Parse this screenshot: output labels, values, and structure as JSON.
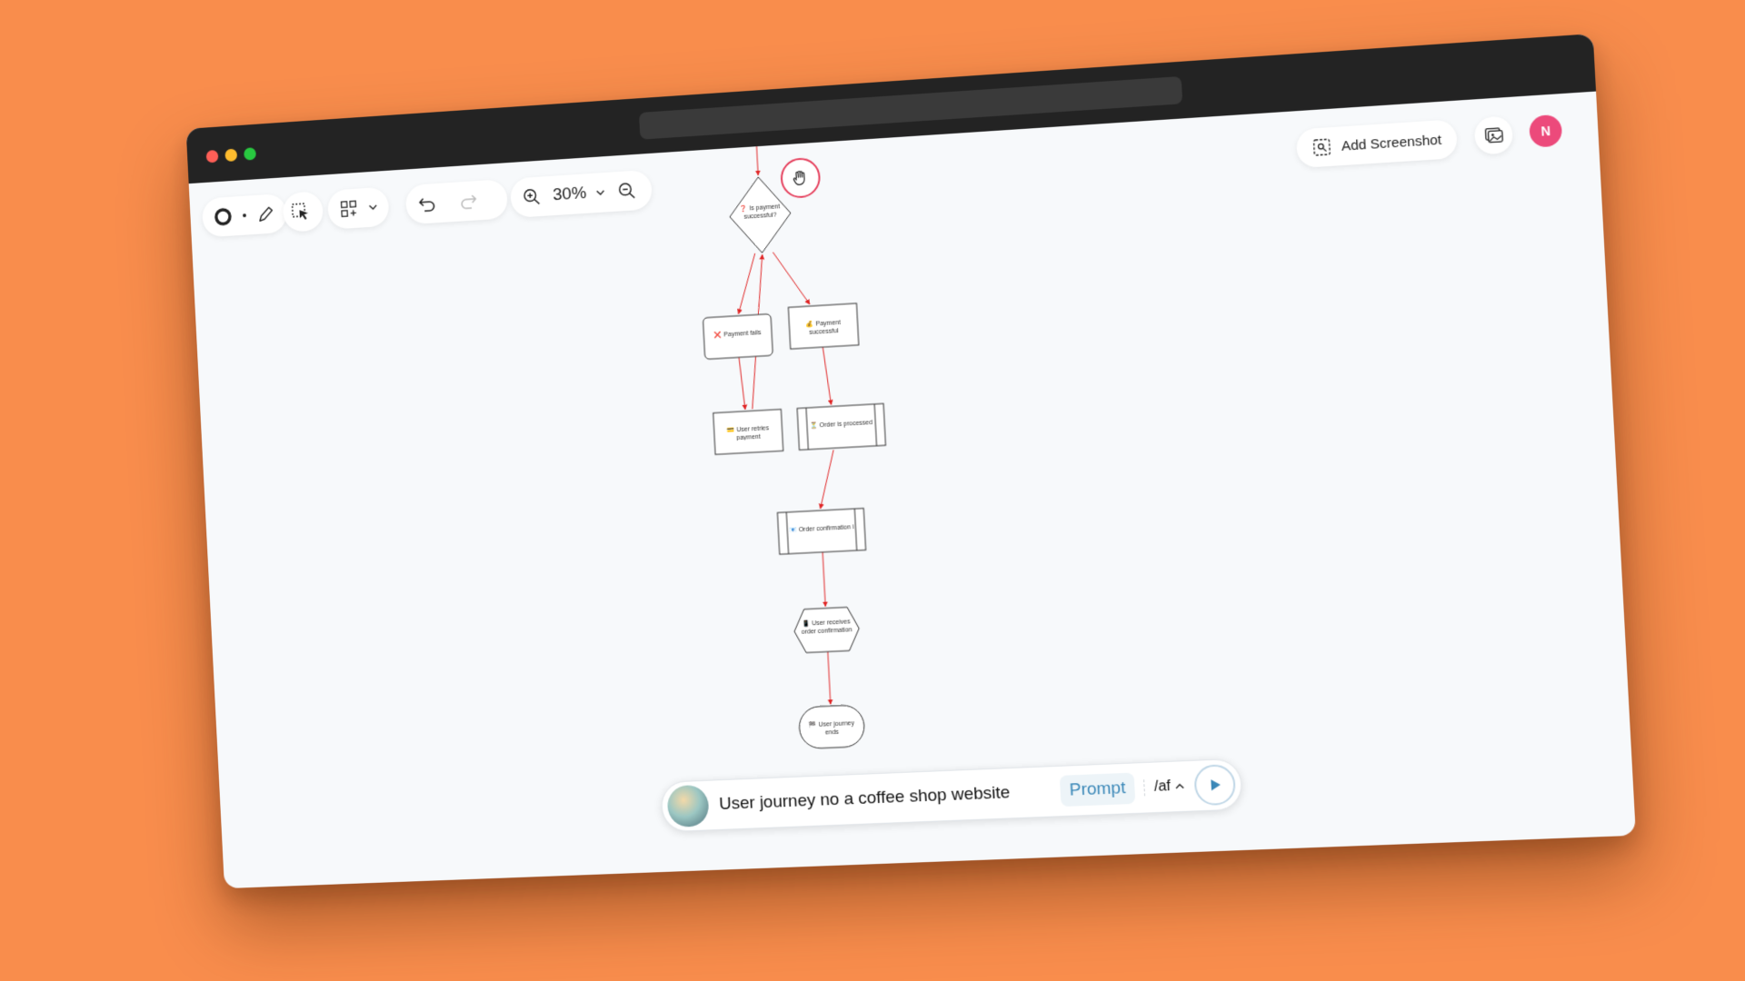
{
  "toolbar": {
    "zoom_level": "30%",
    "screenshot_label": "Add Screenshot"
  },
  "user": {
    "avatar_initial": "N"
  },
  "flowchart": {
    "nodes": {
      "decision": "❓ Is payment successful?",
      "payment_fails": "❌ Payment fails",
      "payment_success": "💰 Payment successful",
      "retry_payment": "💳 User retries payment",
      "order_processed": "⏳ Order is processed",
      "confirmation_sent": "📧 Order confirmation is sent",
      "receives_confirmation": "📱 User receives order confirmation",
      "journey_ends": "🏁 User journey ends"
    }
  },
  "prompt": {
    "text": "User journey no a coffee shop website",
    "tag": "Prompt",
    "command": "/af"
  },
  "colors": {
    "background": "#F98D4C",
    "edge": "#E02424",
    "accent": "#3B88B8"
  }
}
